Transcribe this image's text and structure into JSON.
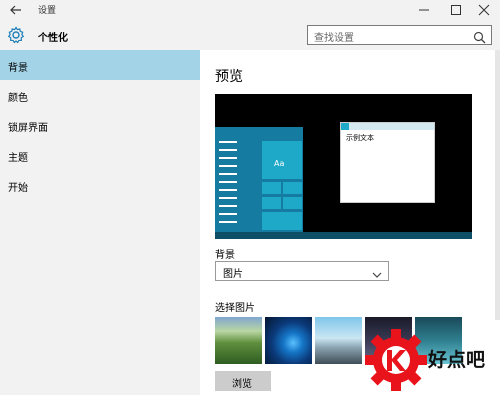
{
  "window": {
    "title": "设置",
    "back_icon": "back-arrow-icon",
    "minimize_icon": "minimize-icon",
    "maximize_icon": "maximize-icon",
    "close_icon": "close-icon"
  },
  "header": {
    "icon": "gear-icon",
    "title": "个性化",
    "search_placeholder": "查找设置",
    "search_icon": "search-icon"
  },
  "sidebar": {
    "items": [
      {
        "label": "背景",
        "active": true
      },
      {
        "label": "颜色",
        "active": false
      },
      {
        "label": "锁屏界面",
        "active": false
      },
      {
        "label": "主题",
        "active": false
      },
      {
        "label": "开始",
        "active": false
      }
    ],
    "active_color": "#a3d3e6"
  },
  "main": {
    "preview_title": "预览",
    "preview": {
      "tile_text": "Aa",
      "sample_text": "示例文本"
    },
    "background_label": "背景",
    "background_value": "图片",
    "choose_picture_label": "选择图片",
    "browse_label": "浏览"
  },
  "watermark": {
    "text": "好点吧"
  },
  "colors": {
    "accent": "#1e7fb8",
    "start_menu": "#167ba0",
    "tile": "#1fa9c8",
    "watermark_red": "#e8131b"
  }
}
